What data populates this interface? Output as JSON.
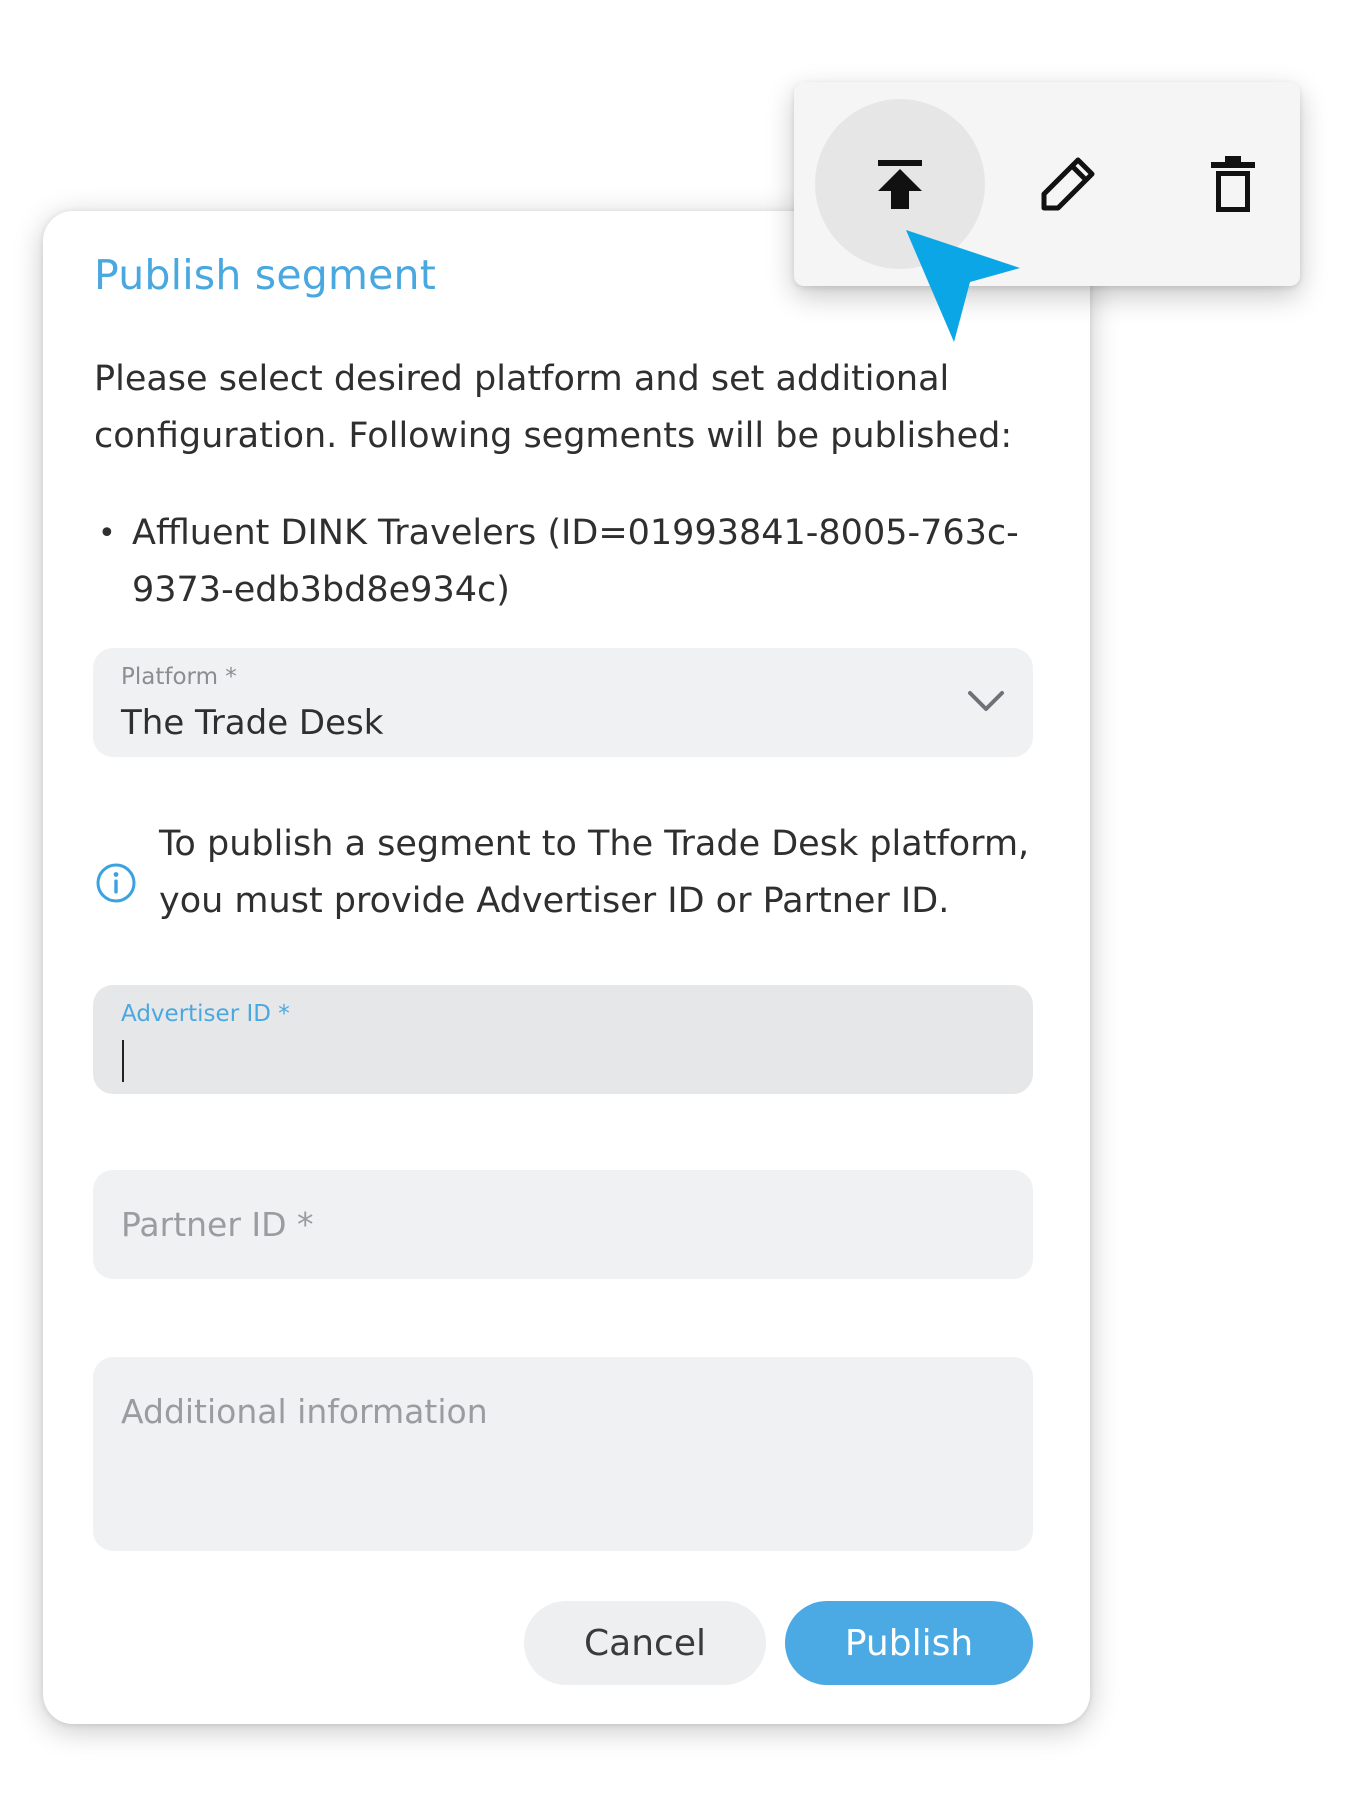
{
  "dialog": {
    "title": "Publish segment",
    "intro": "Please select desired platform and set additional configuration. Following segments will be published:",
    "segments": [
      {
        "text": "Affluent DINK Travelers (ID=01993841-8005-763c-9373-edb3bd8e934c)"
      }
    ],
    "platform": {
      "label": "Platform *",
      "value": "The Trade Desk"
    },
    "info": "To publish a segment to The Trade Desk platform, you must provide Advertiser ID or Partner ID.",
    "advertiser": {
      "label": "Advertiser ID *",
      "value": ""
    },
    "partner": {
      "placeholder": "Partner ID *"
    },
    "additional": {
      "placeholder": "Additional information"
    },
    "buttons": {
      "cancel": "Cancel",
      "publish": "Publish"
    }
  },
  "toolbar": {
    "actions": [
      {
        "icon": "publish-icon"
      },
      {
        "icon": "pencil-icon"
      },
      {
        "icon": "trash-icon"
      }
    ]
  },
  "colors": {
    "accent": "#4aa8e0",
    "cursor": "#0aa6e6",
    "field_bg": "#f0f1f3"
  }
}
